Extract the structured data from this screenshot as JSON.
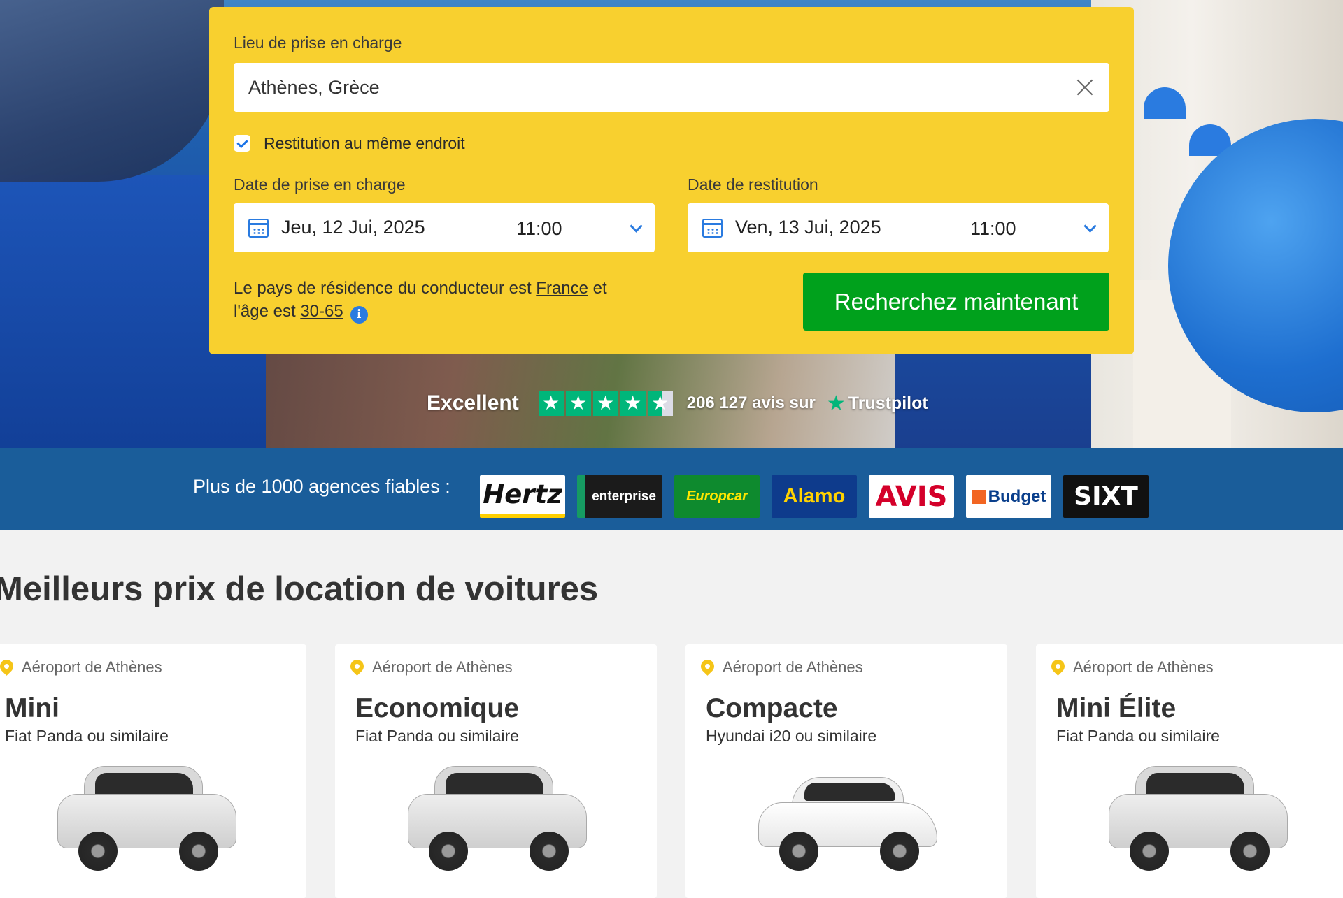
{
  "search": {
    "pickup_label": "Lieu de prise en charge",
    "pickup_value": "Athènes, Grèce",
    "same_return_label": "Restitution au même endroit",
    "same_return_checked": true,
    "pickup_date_label": "Date de prise en charge",
    "pickup_date": "Jeu, 12 Jui, 2025",
    "pickup_time": "11:00",
    "return_date_label": "Date de restitution",
    "return_date": "Ven, 13 Jui, 2025",
    "return_time": "11:00",
    "residence_prefix": "Le pays de résidence du conducteur est",
    "residence_country": "France",
    "residence_mid": "et",
    "age_prefix": "l'âge est",
    "age_range": "30-65",
    "info_icon": "i",
    "search_button": "Recherchez maintenant"
  },
  "trustpilot": {
    "rating_word": "Excellent",
    "stars": 4.5,
    "review_count": "206 127 avis sur",
    "brand": "Trustpilot",
    "star_glyph": "★"
  },
  "agencies": {
    "label": "Plus de 1000 agences fiables :",
    "logos": [
      "Hertz",
      "enterprise",
      "Europcar",
      "Alamo",
      "AVIS",
      "Budget",
      "SIXT"
    ]
  },
  "best_prices": {
    "title": "Meilleurs prix de location de voitures",
    "cards": [
      {
        "location": "Aéroport de Athènes",
        "category": "Mini",
        "model": "Fiat Panda ou similaire"
      },
      {
        "location": "Aéroport de Athènes",
        "category": "Economique",
        "model": "Fiat Panda ou similaire"
      },
      {
        "location": "Aéroport de Athènes",
        "category": "Compacte",
        "model": "Hyundai i20 ou similaire"
      },
      {
        "location": "Aéroport de Athènes",
        "category": "Mini Élite",
        "model": "Fiat Panda ou similaire"
      }
    ]
  },
  "colors": {
    "panel": "#f8d02f",
    "search_button": "#00a11c",
    "accent": "#2a7be0",
    "agencies_bar": "#1a5d9a",
    "trustpilot": "#00b67a"
  }
}
